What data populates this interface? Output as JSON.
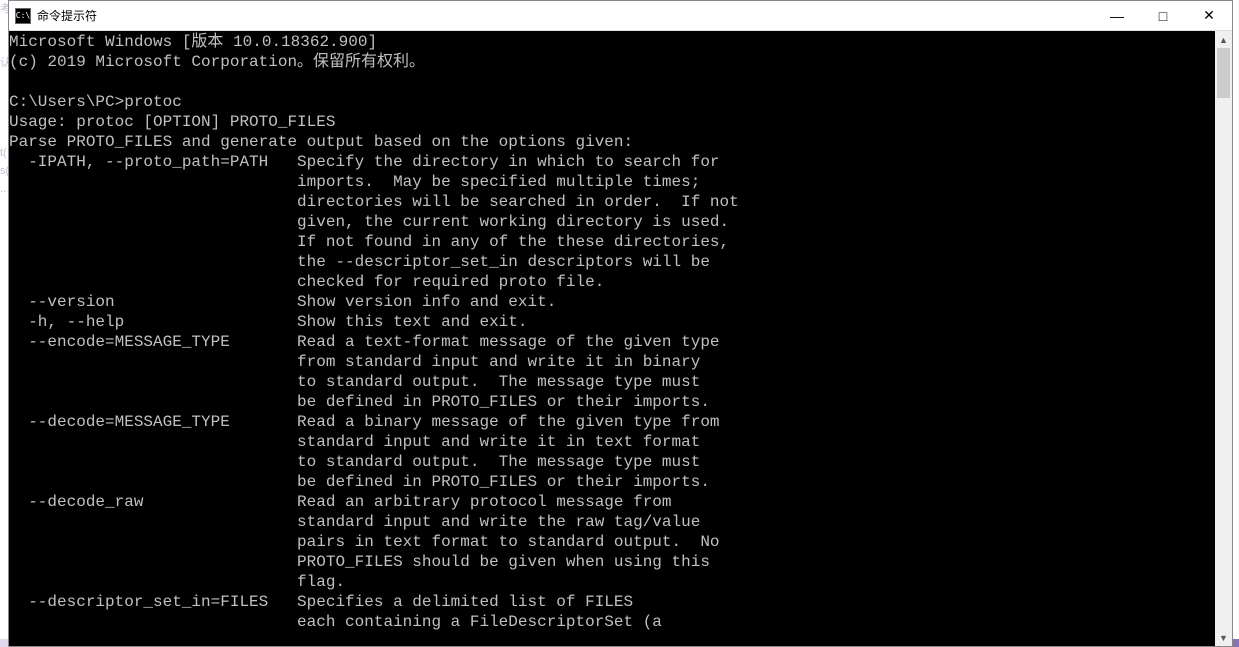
{
  "window": {
    "title": "命令提示符",
    "icon_label": "C:\\"
  },
  "controls": {
    "minimize": "—",
    "maximize": "□",
    "close": "✕"
  },
  "scrollbar": {
    "up": "▲",
    "down": "▼"
  },
  "console": {
    "lines": [
      "Microsoft Windows [版本 10.0.18362.900]",
      "(c) 2019 Microsoft Corporation。保留所有权利。",
      "",
      "C:\\Users\\PC>protoc",
      "Usage: protoc [OPTION] PROTO_FILES",
      "Parse PROTO_FILES and generate output based on the options given:",
      "  -IPATH, --proto_path=PATH   Specify the directory in which to search for",
      "                              imports.  May be specified multiple times;",
      "                              directories will be searched in order.  If not",
      "                              given, the current working directory is used.",
      "                              If not found in any of the these directories,",
      "                              the --descriptor_set_in descriptors will be",
      "                              checked for required proto file.",
      "  --version                   Show version info and exit.",
      "  -h, --help                  Show this text and exit.",
      "  --encode=MESSAGE_TYPE       Read a text-format message of the given type",
      "                              from standard input and write it in binary",
      "                              to standard output.  The message type must",
      "                              be defined in PROTO_FILES or their imports.",
      "  --decode=MESSAGE_TYPE       Read a binary message of the given type from",
      "                              standard input and write it in text format",
      "                              to standard output.  The message type must",
      "                              be defined in PROTO_FILES or their imports.",
      "  --decode_raw                Read an arbitrary protocol message from",
      "                              standard input and write the raw tag/value",
      "                              pairs in text format to standard output.  No",
      "                              PROTO_FILES should be given when using this",
      "                              flag.",
      "  --descriptor_set_in=FILES   Specifies a delimited list of FILES",
      "                              each containing a FileDescriptorSet (a"
    ]
  },
  "bg_hints": [
    "考",
    "认",
    "t(",
    "s(",
    ".."
  ]
}
